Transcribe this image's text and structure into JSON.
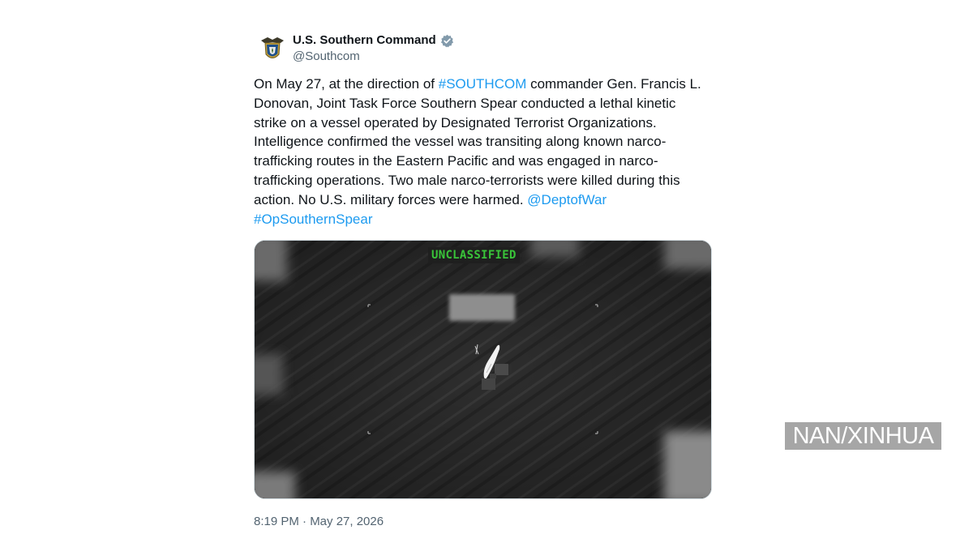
{
  "account": {
    "display_name": "U.S. Southern Command",
    "handle": "@Southcom",
    "verified_icon": "verified-badge-icon",
    "avatar_icon": "southcom-crest-icon"
  },
  "post": {
    "text_segments": [
      {
        "type": "text",
        "value": "On May 27, at the direction of "
      },
      {
        "type": "link",
        "value": "#SOUTHCOM"
      },
      {
        "type": "text",
        "value": " commander Gen. Francis L. Donovan, Joint Task Force Southern Spear conducted a lethal kinetic strike on a vessel operated by Designated Terrorist Organizations. Intelligence confirmed the vessel was transiting along known narco-trafficking routes in the Eastern Pacific and was engaged in narco-trafficking operations. Two male narco-terrorists were killed during this action. No U.S. military forces were harmed. "
      },
      {
        "type": "link",
        "value": "@DeptofWar"
      },
      {
        "type": "text",
        "value": " "
      },
      {
        "type": "link",
        "value": "#OpSouthernSpear"
      }
    ],
    "media_label": "UNCLASSIFIED",
    "timestamp": "8:19 PM · May 27, 2026"
  },
  "credit": "NAN/XINHUA",
  "colors": {
    "link": "#1d9bf0",
    "text": "#0f1419",
    "muted": "#536471",
    "label_green": "#39c339"
  }
}
